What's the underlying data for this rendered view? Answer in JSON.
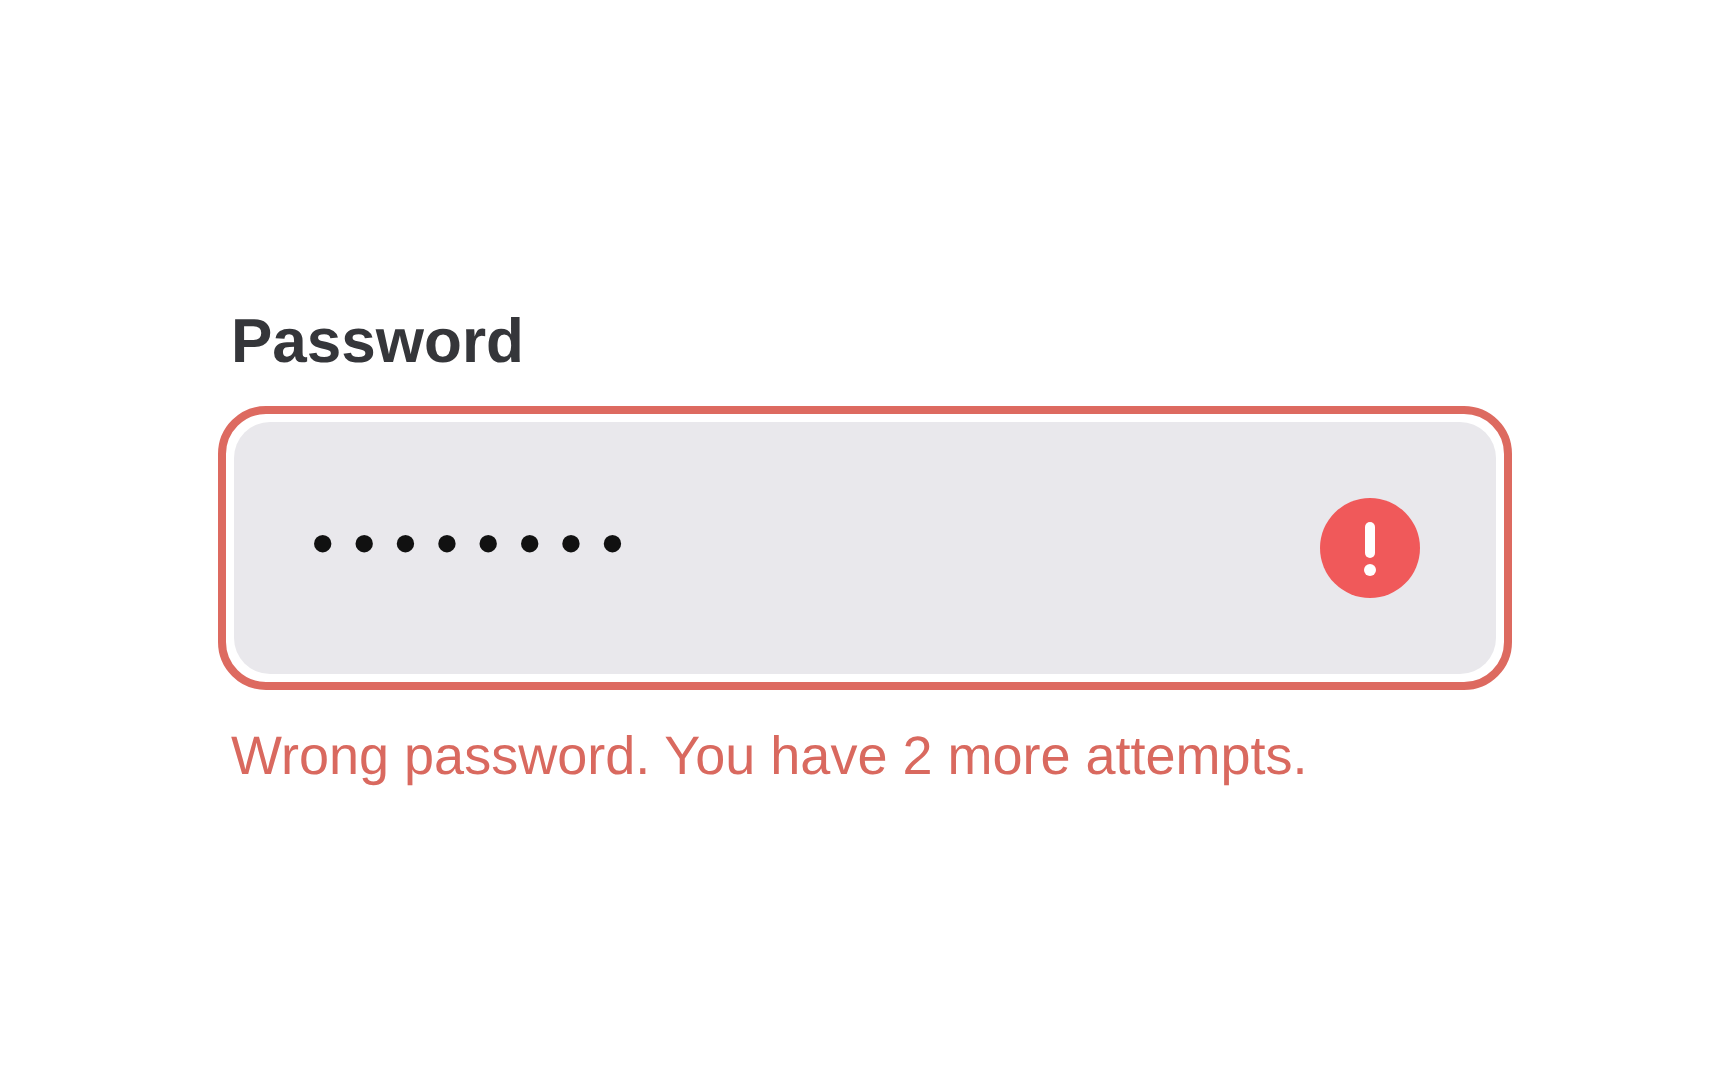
{
  "field": {
    "label": "Password",
    "value": "••••••••",
    "invalid": true
  },
  "error_message": "Wrong password. You have 2 more attempts."
}
